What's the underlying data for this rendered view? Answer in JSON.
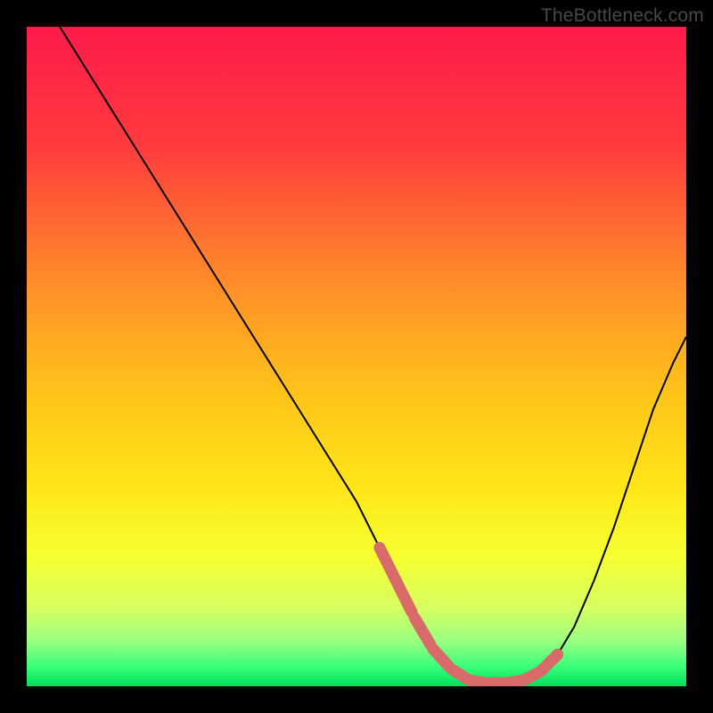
{
  "watermark": "TheBottleneck.com",
  "chart_data": {
    "type": "line",
    "title": "",
    "xlabel": "",
    "ylabel": "",
    "xlim": [
      0,
      100
    ],
    "ylim": [
      0,
      100
    ],
    "gradient_stops": [
      {
        "offset": 0,
        "color": "#ff1a4a"
      },
      {
        "offset": 18,
        "color": "#ff3b3e"
      },
      {
        "offset": 38,
        "color": "#ff8a2a"
      },
      {
        "offset": 55,
        "color": "#ffc21a"
      },
      {
        "offset": 70,
        "color": "#ffe618"
      },
      {
        "offset": 80,
        "color": "#f7ff30"
      },
      {
        "offset": 88,
        "color": "#d8ff60"
      },
      {
        "offset": 93,
        "color": "#9cff80"
      },
      {
        "offset": 97,
        "color": "#3bff7a"
      },
      {
        "offset": 100,
        "color": "#00e05a"
      }
    ],
    "series": [
      {
        "name": "bottleneck-curve",
        "x": [
          5,
          10,
          15,
          20,
          25,
          30,
          35,
          40,
          45,
          50,
          53,
          56,
          59,
          62,
          65,
          68,
          71,
          74,
          77,
          80,
          83,
          86,
          89,
          92,
          95,
          98,
          100
        ],
        "y": [
          100,
          92,
          84,
          76,
          68,
          60,
          52,
          44,
          36,
          28,
          22,
          16,
          10,
          5,
          2,
          0.5,
          0.5,
          0.5,
          1.5,
          4,
          9,
          16,
          24,
          33,
          42,
          49,
          53
        ]
      }
    ],
    "marker_band": {
      "name": "optimal-zone",
      "x_start": 56,
      "x_end": 78,
      "y": 0.5,
      "color": "#d86a6a"
    }
  }
}
